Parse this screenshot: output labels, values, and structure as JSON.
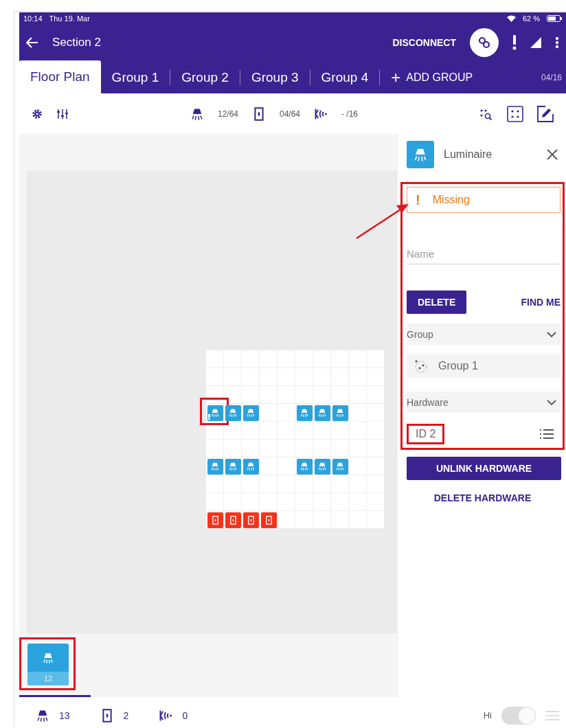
{
  "status_bar": {
    "time": "10:14",
    "date": "Thu 19. Mar",
    "battery": "62 %"
  },
  "app_bar": {
    "title": "Section 2",
    "action": "DISCONNECT"
  },
  "tabs": [
    {
      "label": "Floor Plan",
      "selected": true
    },
    {
      "label": "Group 1",
      "selected": false
    },
    {
      "label": "Group 2",
      "selected": false
    },
    {
      "label": "Group 3",
      "selected": false
    },
    {
      "label": "Group 4",
      "selected": false
    }
  ],
  "add_group": {
    "icon": "+",
    "label": "ADD GROUP"
  },
  "group_count": "04/16",
  "toolbar": {
    "counters": [
      {
        "kind": "luminaire",
        "value": "12/64"
      },
      {
        "kind": "switch",
        "value": "04/64"
      },
      {
        "kind": "sensor",
        "value": "- /16"
      }
    ]
  },
  "grid_rows": [
    {
      "cells": [
        {
          "kind": "empty"
        },
        {
          "kind": "empty"
        },
        {
          "kind": "empty"
        },
        {
          "kind": "empty"
        },
        {
          "kind": "empty"
        },
        {
          "kind": "empty"
        },
        {
          "kind": "empty"
        },
        {
          "kind": "empty"
        },
        {
          "kind": "empty"
        },
        {
          "kind": "empty"
        }
      ]
    },
    {
      "cells": [
        {
          "kind": "empty"
        },
        {
          "kind": "empty"
        },
        {
          "kind": "empty"
        },
        {
          "kind": "empty"
        },
        {
          "kind": "empty"
        },
        {
          "kind": "empty"
        },
        {
          "kind": "empty"
        },
        {
          "kind": "empty"
        },
        {
          "kind": "empty"
        },
        {
          "kind": "empty"
        }
      ]
    },
    {
      "cells": [
        {
          "kind": "empty"
        },
        {
          "kind": "empty"
        },
        {
          "kind": "empty"
        },
        {
          "kind": "empty"
        },
        {
          "kind": "empty"
        },
        {
          "kind": "empty"
        },
        {
          "kind": "empty"
        },
        {
          "kind": "empty"
        },
        {
          "kind": "empty"
        },
        {
          "kind": "empty"
        }
      ]
    },
    {
      "cells": [
        {
          "kind": "missing"
        },
        {
          "kind": "luminaire"
        },
        {
          "kind": "luminaire"
        },
        {
          "kind": "empty"
        },
        {
          "kind": "empty"
        },
        {
          "kind": "luminaire"
        },
        {
          "kind": "luminaire"
        },
        {
          "kind": "luminaire"
        },
        {
          "kind": "empty"
        },
        {
          "kind": "empty"
        }
      ]
    },
    {
      "cells": [
        {
          "kind": "empty"
        },
        {
          "kind": "empty"
        },
        {
          "kind": "empty"
        },
        {
          "kind": "empty"
        },
        {
          "kind": "empty"
        },
        {
          "kind": "empty"
        },
        {
          "kind": "empty"
        },
        {
          "kind": "empty"
        },
        {
          "kind": "empty"
        },
        {
          "kind": "empty"
        }
      ]
    },
    {
      "cells": [
        {
          "kind": "empty"
        },
        {
          "kind": "empty"
        },
        {
          "kind": "empty"
        },
        {
          "kind": "empty"
        },
        {
          "kind": "empty"
        },
        {
          "kind": "empty"
        },
        {
          "kind": "empty"
        },
        {
          "kind": "empty"
        },
        {
          "kind": "empty"
        },
        {
          "kind": "empty"
        }
      ]
    },
    {
      "cells": [
        {
          "kind": "luminaire"
        },
        {
          "kind": "luminaire"
        },
        {
          "kind": "luminaire"
        },
        {
          "kind": "empty"
        },
        {
          "kind": "empty"
        },
        {
          "kind": "luminaire"
        },
        {
          "kind": "luminaire"
        },
        {
          "kind": "luminaire"
        },
        {
          "kind": "empty"
        },
        {
          "kind": "empty"
        }
      ]
    },
    {
      "cells": [
        {
          "kind": "empty"
        },
        {
          "kind": "empty"
        },
        {
          "kind": "empty"
        },
        {
          "kind": "empty"
        },
        {
          "kind": "empty"
        },
        {
          "kind": "empty"
        },
        {
          "kind": "empty"
        },
        {
          "kind": "empty"
        },
        {
          "kind": "empty"
        },
        {
          "kind": "empty"
        }
      ]
    },
    {
      "cells": [
        {
          "kind": "empty"
        },
        {
          "kind": "empty"
        },
        {
          "kind": "empty"
        },
        {
          "kind": "empty"
        },
        {
          "kind": "empty"
        },
        {
          "kind": "empty"
        },
        {
          "kind": "empty"
        },
        {
          "kind": "empty"
        },
        {
          "kind": "empty"
        },
        {
          "kind": "empty"
        }
      ]
    },
    {
      "cells": [
        {
          "kind": "switch"
        },
        {
          "kind": "switch"
        },
        {
          "kind": "switch"
        },
        {
          "kind": "switch"
        },
        {
          "kind": "empty"
        },
        {
          "kind": "empty"
        },
        {
          "kind": "empty"
        },
        {
          "kind": "empty"
        },
        {
          "kind": "empty"
        },
        {
          "kind": "empty"
        }
      ]
    }
  ],
  "tray": [
    {
      "kind": "luminaire",
      "count": "12"
    }
  ],
  "panel": {
    "title": "Luminaire",
    "status_icon": "!",
    "status": "Missing",
    "name_placeholder": "Name",
    "delete": "DELETE",
    "find_me": "FIND ME",
    "sections": [
      {
        "title": "Group",
        "expanded": true,
        "item": {
          "kind": "group",
          "label": "Group 1"
        }
      },
      {
        "title": "Hardware",
        "expanded": true,
        "item": {
          "kind": "hardware",
          "label": "ID 2"
        }
      }
    ],
    "unlink": "UNLINK HARDWARE",
    "delete_hardware": "DELETE HARDWARE"
  },
  "footer": {
    "counters": [
      {
        "kind": "luminaire",
        "value": "13"
      },
      {
        "kind": "switch",
        "value": "2"
      },
      {
        "kind": "sensor",
        "value": "0"
      }
    ],
    "toggle_label": "Hi",
    "toggle_on": true
  }
}
